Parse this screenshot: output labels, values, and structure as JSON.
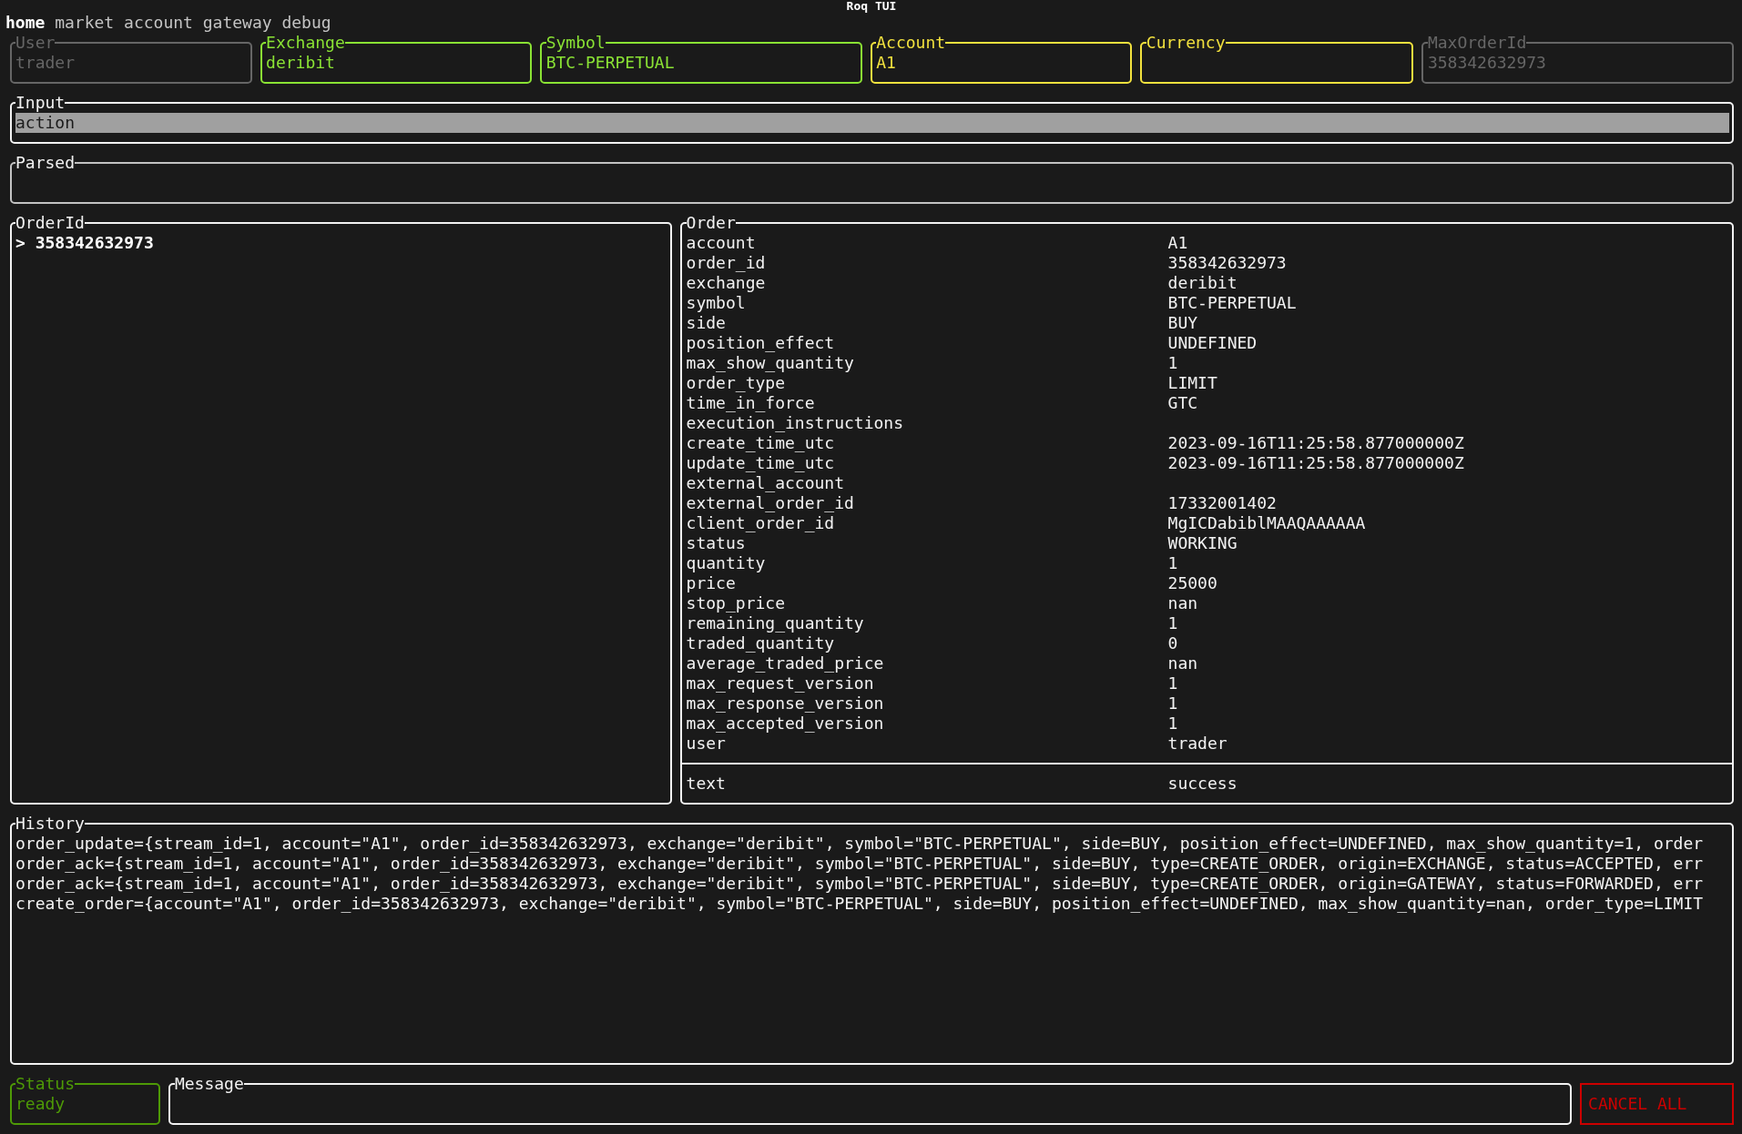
{
  "window": {
    "title": "Roq TUI"
  },
  "tabs": [
    {
      "label": "home",
      "selected": true
    },
    {
      "label": "market",
      "selected": false
    },
    {
      "label": "account",
      "selected": false
    },
    {
      "label": "gateway",
      "selected": false
    },
    {
      "label": "debug",
      "selected": false
    }
  ],
  "fields": [
    {
      "label": "User",
      "value": "trader",
      "color": "#666666"
    },
    {
      "label": "Exchange",
      "value": "deribit",
      "color": "#8ae234"
    },
    {
      "label": "Symbol",
      "value": "BTC-PERPETUAL",
      "color": "#8ae234"
    },
    {
      "label": "Account",
      "value": "A1",
      "color": "#f2e13e"
    },
    {
      "label": "Currency",
      "color": "#f2e13e"
    },
    {
      "label": "MaxOrderId",
      "value": "358342632973",
      "color": "#666666"
    }
  ],
  "input": {
    "label": "Input",
    "value": "action"
  },
  "parsed": {
    "label": "Parsed"
  },
  "order_ids": {
    "label": "OrderId",
    "highlight_symbol": ">",
    "items": [
      {
        "text": "358342632973",
        "selected": true
      }
    ]
  },
  "order": {
    "label": "Order",
    "rows": [
      {
        "key": "account",
        "value": "A1"
      },
      {
        "key": "order_id",
        "value": "358342632973"
      },
      {
        "key": "exchange",
        "value": "deribit"
      },
      {
        "key": "symbol",
        "value": "BTC-PERPETUAL"
      },
      {
        "key": "side",
        "value": "BUY"
      },
      {
        "key": "position_effect",
        "value": "UNDEFINED"
      },
      {
        "key": "max_show_quantity",
        "value": "1"
      },
      {
        "key": "order_type",
        "value": "LIMIT"
      },
      {
        "key": "time_in_force",
        "value": "GTC"
      },
      {
        "key": "execution_instructions"
      },
      {
        "key": "create_time_utc",
        "value": "2023-09-16T11:25:58.877000000Z"
      },
      {
        "key": "update_time_utc",
        "value": "2023-09-16T11:25:58.877000000Z"
      },
      {
        "key": "external_account"
      },
      {
        "key": "external_order_id",
        "value": "17332001402"
      },
      {
        "key": "client_order_id",
        "value": "MgICDabiblMAAQAAAAAA"
      },
      {
        "key": "status",
        "value": "WORKING"
      },
      {
        "key": "quantity",
        "value": "1"
      },
      {
        "key": "price",
        "value": "25000"
      },
      {
        "key": "stop_price",
        "value": "nan"
      },
      {
        "key": "remaining_quantity",
        "value": "1"
      },
      {
        "key": "traded_quantity",
        "value": "0"
      },
      {
        "key": "average_traded_price",
        "value": "nan"
      },
      {
        "key": "max_request_version",
        "value": "1"
      },
      {
        "key": "max_response_version",
        "value": "1"
      },
      {
        "key": "max_accepted_version",
        "value": "1"
      },
      {
        "key": "user",
        "value": "trader"
      }
    ],
    "footer_rows": [
      {
        "key": "text",
        "value": "success"
      }
    ]
  },
  "history": {
    "label": "History",
    "lines": [
      "order_update={stream_id=1, account=\"A1\", order_id=358342632973, exchange=\"deribit\", symbol=\"BTC-PERPETUAL\", side=BUY, position_effect=UNDEFINED, max_show_quantity=1, order",
      "order_ack={stream_id=1, account=\"A1\", order_id=358342632973, exchange=\"deribit\", symbol=\"BTC-PERPETUAL\", side=BUY, type=CREATE_ORDER, origin=EXCHANGE, status=ACCEPTED, err",
      "order_ack={stream_id=1, account=\"A1\", order_id=358342632973, exchange=\"deribit\", symbol=\"BTC-PERPETUAL\", side=BUY, type=CREATE_ORDER, origin=GATEWAY, status=FORWARDED, err",
      "create_order={account=\"A1\", order_id=358342632973, exchange=\"deribit\", symbol=\"BTC-PERPETUAL\", side=BUY, position_effect=UNDEFINED, max_show_quantity=nan, order_type=LIMIT"
    ]
  },
  "status": {
    "label": "Status",
    "value": "ready"
  },
  "message": {
    "label": "Message"
  },
  "cancel_button": {
    "label": "CANCEL ALL"
  }
}
